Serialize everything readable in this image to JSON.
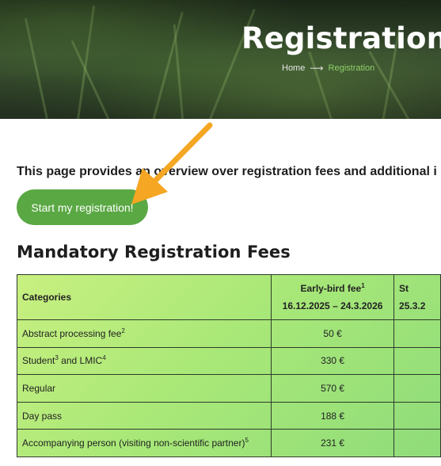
{
  "hero": {
    "title": "Registration",
    "breadcrumb": {
      "home": "Home",
      "separator": "⟶",
      "current": "Registration"
    }
  },
  "intro": {
    "text": "This page provides an overview over registration fees and additional i"
  },
  "cta": {
    "label": "Start my registration!"
  },
  "section": {
    "title": "Mandatory Registration Fees"
  },
  "fees_table": {
    "header": {
      "categories": "Categories",
      "early_bird_label": "Early-bird fee",
      "early_bird_note": "1",
      "early_bird_dates": "16.12.2025 – 24.3.2026",
      "standard_label_partial": "St",
      "standard_dates_partial": "25.3.2"
    },
    "rows": [
      {
        "category": "Abstract processing fee",
        "note": "2",
        "early": "50 €"
      },
      {
        "category_a": "Student",
        "note_a": "3",
        "category_b": " and LMIC",
        "note_b": "4",
        "early": "330 €"
      },
      {
        "category": "Regular",
        "early": "570 €"
      },
      {
        "category": "Day pass",
        "early": "188 €"
      },
      {
        "category": "Accompanying person (visiting non-scientific partner)",
        "note": "5",
        "early": "231 €"
      }
    ]
  },
  "colors": {
    "accent_green": "#5aa843",
    "breadcrumb_active": "#8fd06a",
    "annotation_arrow": "#f5a623",
    "table_gradient_start": "#c8f080",
    "table_gradient_end": "#8fdc7a"
  }
}
